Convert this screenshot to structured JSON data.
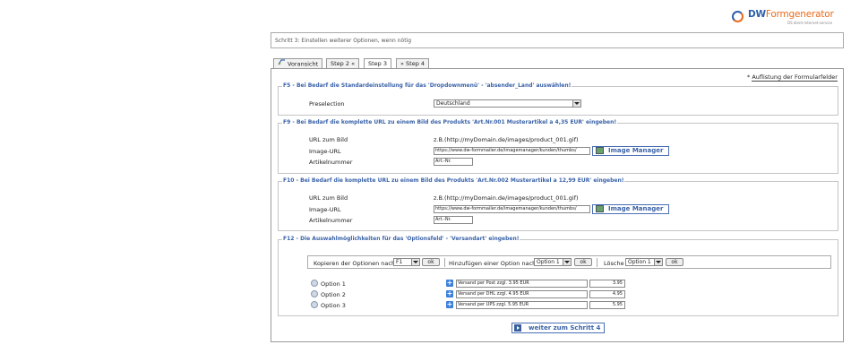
{
  "logo": {
    "brand_primary": "DW",
    "brand_accent": "Formgenerator",
    "tagline": "DS dient-internet-service"
  },
  "step_title": "Schritt 3: Einstellen weiterer Optionen, wenn nötig",
  "tabs": [
    {
      "label": "Voransicht",
      "icon": "preview-icon"
    },
    {
      "label": "Step 2 «"
    },
    {
      "label": "Step 3",
      "active": true
    },
    {
      "label": "» Step 4"
    }
  ],
  "note": {
    "star": "*",
    "text": "Auflistung der Formularfelder"
  },
  "f5": {
    "legend": "F5 - Bei Bedarf die Standardeinstellung für das 'Dropdownmenü' - 'absender_Land' auswählen!",
    "preselection_label": "Preselection",
    "preselection_value": "Deutschland"
  },
  "f9": {
    "legend": "F9 - Bei Bedarf die komplette URL zu einem Bild des Produkts 'Art.Nr.001 Musterartikel a 4,35 EUR' eingeben!",
    "url_label": "URL zum Bild",
    "url_example": "z.B.(http://myDomain.de/images/product_001.gif)",
    "image_url_label": "Image-URL",
    "image_url_value": "https://www.dw-formmailer.de/imagemanager/kunden/thumbs/",
    "image_manager": "Image Manager",
    "artikel_label": "Artikelnummer",
    "artikel_value": "Art.-Nr."
  },
  "f10": {
    "legend": "F10 - Bei Bedarf die komplette URL zu einem Bild des Produkts 'Art.Nr.002 Musterartikel a 12,99 EUR' eingeben!",
    "url_label": "URL zum Bild",
    "url_example": "z.B.(http://myDomain.de/images/product_001.gif)",
    "image_url_label": "Image-URL",
    "image_url_value": "https://www.dw-formmailer.de/imagemanager/kunden/thumbs/",
    "image_manager": "Image Manager",
    "artikel_label": "Artikelnummer",
    "artikel_value": "Art.-Nr."
  },
  "f12": {
    "legend": "F12 - Die Auswahlmöglichkeiten für das 'Optionsfeld' - 'Versandart' eingeben!",
    "copy_label": "Kopieren der Optionen nach",
    "copy_value": "F1",
    "ok": "ok",
    "add_label": "Hinzufügen einer Option nach",
    "add_value": "Option 1",
    "delete_label": "Lösche",
    "delete_value": "Option 1",
    "options": [
      {
        "label": "Option 1",
        "text": "Versand per Post zzgl. 3.95 EUR",
        "price": "3.95"
      },
      {
        "label": "Option 2",
        "text": "Versand per DHL zzgl. 4.95 EUR",
        "price": "4.95"
      },
      {
        "label": "Option 3",
        "text": "Versand per UPS zzgl. 5.95 EUR",
        "price": "5.95"
      }
    ]
  },
  "next_button": "weiter zum Schritt 4",
  "colors": {
    "brand_blue": "#2b5fa8",
    "brand_orange": "#e96b1c",
    "legend_blue": "#3a63a8",
    "plus_blue": "#3b7fd9"
  }
}
